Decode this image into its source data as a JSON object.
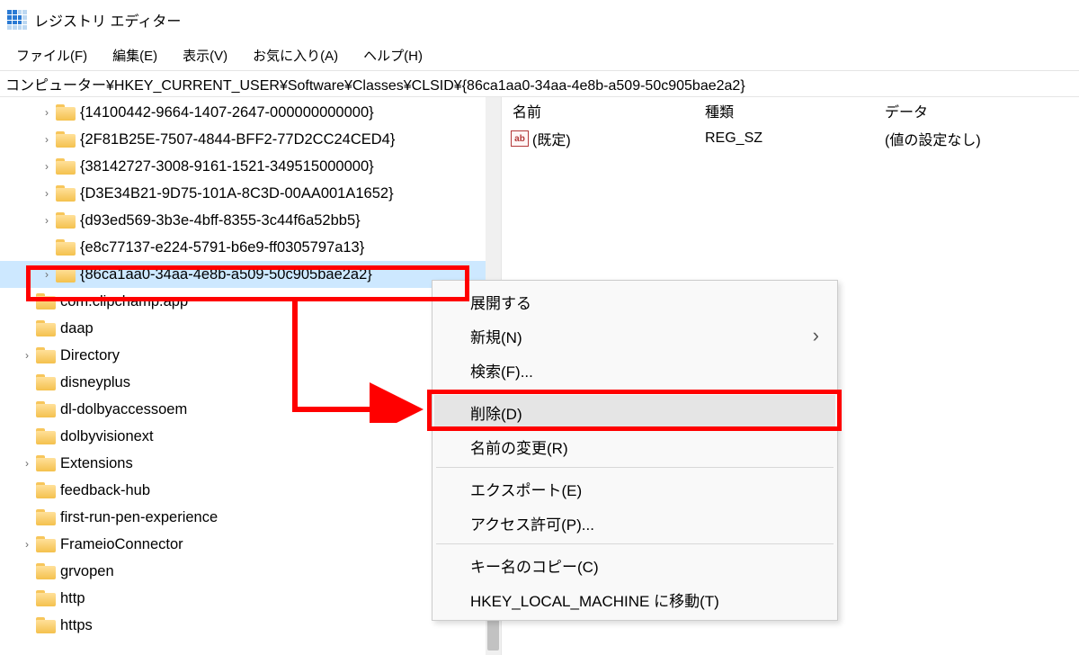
{
  "app": {
    "title": "レジストリ エディター"
  },
  "menu": {
    "file": "ファイル(F)",
    "edit": "編集(E)",
    "view": "表示(V)",
    "fav": "お気に入り(A)",
    "help": "ヘルプ(H)"
  },
  "address": "コンピューター¥HKEY_CURRENT_USER¥Software¥Classes¥CLSID¥{86ca1aa0-34aa-4e8b-a509-50c905bae2a2}",
  "tree": [
    {
      "indent": 2,
      "chev": true,
      "label": "{14100442-9664-1407-2647-000000000000}"
    },
    {
      "indent": 2,
      "chev": true,
      "label": "{2F81B25E-7507-4844-BFF2-77D2CC24CED4}"
    },
    {
      "indent": 2,
      "chev": true,
      "label": "{38142727-3008-9161-1521-349515000000}"
    },
    {
      "indent": 2,
      "chev": true,
      "label": "{D3E34B21-9D75-101A-8C3D-00AA001A1652}"
    },
    {
      "indent": 2,
      "chev": true,
      "label": "{d93ed569-3b3e-4bff-8355-3c44f6a52bb5}"
    },
    {
      "indent": 2,
      "chev": false,
      "label": "{e8c77137-e224-5791-b6e9-ff0305797a13}"
    },
    {
      "indent": 2,
      "chev": true,
      "label": "{86ca1aa0-34aa-4e8b-a509-50c905bae2a2}",
      "selected": true,
      "trunc": true
    },
    {
      "indent": 1,
      "chev": false,
      "label": "com.clipchamp.app"
    },
    {
      "indent": 1,
      "chev": false,
      "label": "daap"
    },
    {
      "indent": 1,
      "chev": true,
      "label": "Directory"
    },
    {
      "indent": 1,
      "chev": false,
      "label": "disneyplus"
    },
    {
      "indent": 1,
      "chev": false,
      "label": "dl-dolbyaccessoem"
    },
    {
      "indent": 1,
      "chev": false,
      "label": "dolbyvisionext"
    },
    {
      "indent": 1,
      "chev": true,
      "label": "Extensions"
    },
    {
      "indent": 1,
      "chev": false,
      "label": "feedback-hub"
    },
    {
      "indent": 1,
      "chev": false,
      "label": "first-run-pen-experience"
    },
    {
      "indent": 1,
      "chev": true,
      "label": "FrameioConnector"
    },
    {
      "indent": 1,
      "chev": false,
      "label": "grvopen"
    },
    {
      "indent": 1,
      "chev": false,
      "label": "http"
    },
    {
      "indent": 1,
      "chev": false,
      "label": "https"
    }
  ],
  "list": {
    "headers": {
      "name": "名前",
      "type": "種類",
      "data": "データ"
    },
    "rows": [
      {
        "icon": "ab",
        "name": "(既定)",
        "type": "REG_SZ",
        "data": "(値の設定なし)"
      }
    ]
  },
  "context_menu": {
    "expand": "展開する",
    "new": "新規(N)",
    "find": "検索(F)...",
    "delete": "削除(D)",
    "rename": "名前の変更(R)",
    "export": "エクスポート(E)",
    "perm": "アクセス許可(P)...",
    "copykey": "キー名のコピー(C)",
    "moveto": "HKEY_LOCAL_MACHINE に移動(T)"
  }
}
